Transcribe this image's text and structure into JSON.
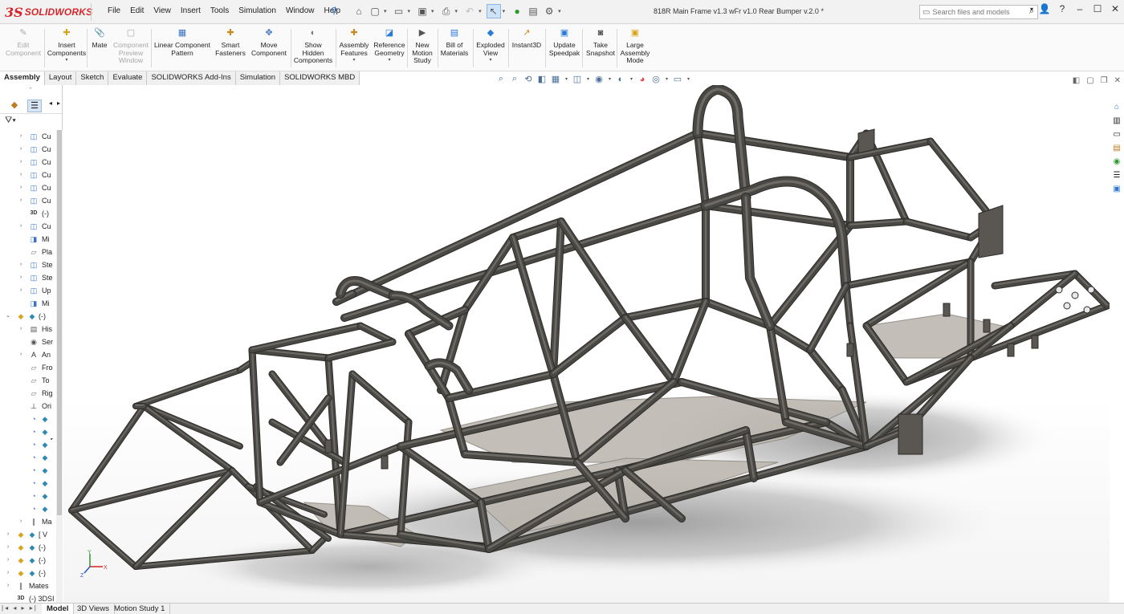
{
  "app": {
    "logo_prefix": "3S",
    "logo_text": "SOLIDWORKS",
    "document_title": "818R Main Frame v1.3 wFr v1.0 Rear Bumper v.2.0 *"
  },
  "menu": [
    "File",
    "Edit",
    "View",
    "Insert",
    "Tools",
    "Simulation",
    "Window",
    "Help"
  ],
  "search": {
    "placeholder": "Search files and models"
  },
  "command_manager": [
    {
      "label": "Edit\nComponent",
      "icon": "edit-component-icon",
      "enabled": false
    },
    {
      "label": "Insert\nComponents",
      "icon": "insert-components-icon",
      "enabled": true
    },
    {
      "label": "Mate",
      "icon": "mate-icon",
      "enabled": true
    },
    {
      "label": "Component\nPreview\nWindow",
      "icon": "component-preview-icon",
      "enabled": false
    },
    {
      "label": "Linear Component\nPattern",
      "icon": "linear-pattern-icon",
      "enabled": true
    },
    {
      "label": "Smart\nFasteners",
      "icon": "smart-fasteners-icon",
      "enabled": true
    },
    {
      "label": "Move\nComponent",
      "icon": "move-component-icon",
      "enabled": true
    },
    {
      "label": "Show\nHidden\nComponents",
      "icon": "show-hidden-icon",
      "enabled": true
    },
    {
      "label": "Assembly\nFeatures",
      "icon": "assembly-features-icon",
      "enabled": true
    },
    {
      "label": "Reference\nGeometry",
      "icon": "reference-geometry-icon",
      "enabled": true
    },
    {
      "label": "New\nMotion\nStudy",
      "icon": "motion-study-icon",
      "enabled": true
    },
    {
      "label": "Bill of\nMaterials",
      "icon": "bom-icon",
      "enabled": true
    },
    {
      "label": "Exploded\nView",
      "icon": "exploded-view-icon",
      "enabled": true
    },
    {
      "label": "Instant3D",
      "icon": "instant3d-icon",
      "enabled": true
    },
    {
      "label": "Update\nSpeedpak",
      "icon": "speedpak-icon",
      "enabled": true
    },
    {
      "label": "Take\nSnapshot",
      "icon": "snapshot-icon",
      "enabled": true
    },
    {
      "label": "Large\nAssembly\nMode",
      "icon": "large-assembly-icon",
      "enabled": true
    }
  ],
  "tabs": [
    "Assembly",
    "Layout",
    "Sketch",
    "Evaluate",
    "SOLIDWORKS Add-Ins",
    "Simulation",
    "SOLIDWORKS MBD"
  ],
  "active_tab": "Assembly",
  "feature_tree": [
    {
      "label": "Cu",
      "indent": 1,
      "expand": "›",
      "icon": "part-icon"
    },
    {
      "label": "Cu",
      "indent": 1,
      "expand": "›",
      "icon": "part-icon"
    },
    {
      "label": "Cu",
      "indent": 1,
      "expand": "›",
      "icon": "part-icon"
    },
    {
      "label": "Cu",
      "indent": 1,
      "expand": "›",
      "icon": "part-icon"
    },
    {
      "label": "Cu",
      "indent": 1,
      "expand": "›",
      "icon": "part-icon"
    },
    {
      "label": "Cu",
      "indent": 1,
      "expand": "›",
      "icon": "part-icon"
    },
    {
      "label": "(-)",
      "indent": 1,
      "expand": "",
      "icon": "3d-sketch-icon"
    },
    {
      "label": "Cu",
      "indent": 1,
      "expand": "›",
      "icon": "part-icon"
    },
    {
      "label": "Mi",
      "indent": 1,
      "expand": "",
      "icon": "mirror-icon"
    },
    {
      "label": "Pla",
      "indent": 1,
      "expand": "",
      "icon": "plane-icon"
    },
    {
      "label": "Ste",
      "indent": 1,
      "expand": "›",
      "icon": "part-icon"
    },
    {
      "label": "Ste",
      "indent": 1,
      "expand": "›",
      "icon": "part-icon"
    },
    {
      "label": "Up",
      "indent": 1,
      "expand": "›",
      "icon": "part-icon"
    },
    {
      "label": "Mi",
      "indent": 1,
      "expand": "",
      "icon": "mirror-icon"
    },
    {
      "label": "(-)",
      "indent": 0,
      "expand": "⌄",
      "icon": "subassembly-icon"
    },
    {
      "label": "His",
      "indent": 1,
      "expand": "›",
      "icon": "history-icon"
    },
    {
      "label": "Ser",
      "indent": 1,
      "expand": "",
      "icon": "sensor-icon"
    },
    {
      "label": "An",
      "indent": 1,
      "expand": "›",
      "icon": "annotation-icon"
    },
    {
      "label": "Fro",
      "indent": 1,
      "expand": "",
      "icon": "plane-icon"
    },
    {
      "label": "To",
      "indent": 1,
      "expand": "",
      "icon": "plane-icon"
    },
    {
      "label": "Rig",
      "indent": 1,
      "expand": "",
      "icon": "plane-icon"
    },
    {
      "label": "Ori",
      "indent": 1,
      "expand": "",
      "icon": "origin-icon"
    },
    {
      "label": "",
      "indent": 1,
      "expand": "",
      "icon": "component-icon"
    },
    {
      "label": "",
      "indent": 1,
      "expand": "",
      "icon": "component-icon"
    },
    {
      "label": "",
      "indent": 1,
      "expand": "",
      "icon": "component-icon",
      "selected": true
    },
    {
      "label": "",
      "indent": 1,
      "expand": "",
      "icon": "component-icon"
    },
    {
      "label": "",
      "indent": 1,
      "expand": "",
      "icon": "component-icon"
    },
    {
      "label": "",
      "indent": 1,
      "expand": "",
      "icon": "component-icon"
    },
    {
      "label": "",
      "indent": 1,
      "expand": "",
      "icon": "component-icon"
    },
    {
      "label": "",
      "indent": 1,
      "expand": "",
      "icon": "component-icon"
    },
    {
      "label": "Ma",
      "indent": 1,
      "expand": "›",
      "icon": "mates-icon"
    },
    {
      "label": "[ V",
      "indent": 0,
      "expand": "›",
      "icon": "subassembly-icon"
    },
    {
      "label": "(-)",
      "indent": 0,
      "expand": "›",
      "icon": "subassembly-icon"
    },
    {
      "label": "(-)",
      "indent": 0,
      "expand": "›",
      "icon": "subassembly-icon"
    },
    {
      "label": "(-)",
      "indent": 0,
      "expand": "›",
      "icon": "subassembly-icon"
    },
    {
      "label": "Mates",
      "indent": 0,
      "expand": "›",
      "icon": "mates-icon"
    },
    {
      "label": "(-) 3DSI",
      "indent": 0,
      "expand": "",
      "icon": "3d-sketch-icon"
    }
  ],
  "bottom_tabs": [
    "Model",
    "3D Views",
    "Motion Study 1"
  ],
  "active_bottom_tab": "Model",
  "colors": {
    "accent": "#2b7ad6",
    "brand": "#d7262a",
    "tube": "#4a4844",
    "tube_hi": "#6e6b66",
    "plate": "#bdb8b0"
  }
}
